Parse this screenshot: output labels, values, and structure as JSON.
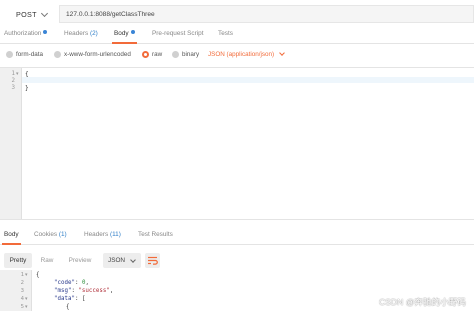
{
  "request": {
    "method": "POST",
    "url": "127.0.0.1:8088/getClassThree"
  },
  "request_tabs": [
    {
      "label": "Authorization",
      "dot": true
    },
    {
      "label": "Headers",
      "count": "(2)"
    },
    {
      "label": "Body",
      "dot": true,
      "active": true
    },
    {
      "label": "Pre-request Script"
    },
    {
      "label": "Tests"
    }
  ],
  "body_types": {
    "options": [
      "form-data",
      "x-www-form-urlencoded",
      "raw",
      "binary"
    ],
    "selected": "raw",
    "format": "JSON (application/json)"
  },
  "editor": {
    "line_numbers": [
      "1",
      "2",
      "3"
    ],
    "lines": [
      "{",
      "",
      "}"
    ]
  },
  "response_tabs": [
    {
      "label": "Body",
      "active": true
    },
    {
      "label": "Cookies",
      "count": "(1)"
    },
    {
      "label": "Headers",
      "count": "(11)"
    },
    {
      "label": "Test Results"
    }
  ],
  "response_toolbar": {
    "modes": [
      "Pretty",
      "Raw",
      "Preview"
    ],
    "active_mode": "Pretty",
    "format": "JSON"
  },
  "response_body": {
    "line_numbers": [
      "1",
      "2",
      "3",
      "4",
      "5"
    ],
    "key_code": "\"code\"",
    "val_code": "0",
    "key_msg": "\"msg\"",
    "val_msg": "\"success\"",
    "key_data": "\"data\"",
    "open_bracket": "[",
    "open_brace": "{"
  },
  "watermark": "CSDN @奔驰的小野码",
  "colors": {
    "accent": "#f26b3a",
    "link": "#2e7ec8"
  }
}
